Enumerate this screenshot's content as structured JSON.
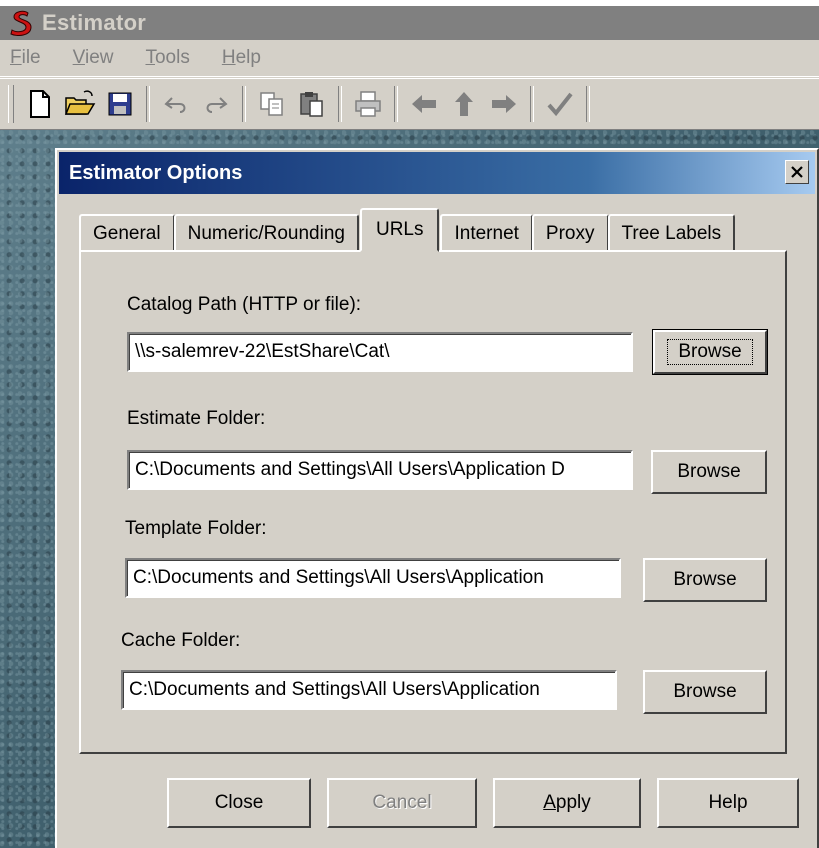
{
  "app": {
    "title": "Estimator",
    "logo_icon": "s-logo-icon"
  },
  "menu": [
    {
      "label_underlined": "F",
      "label_rest": "ile"
    },
    {
      "label_underlined": "V",
      "label_rest": "iew"
    },
    {
      "label_underlined": "T",
      "label_rest": "ools"
    },
    {
      "label_underlined": "H",
      "label_rest": "elp"
    }
  ],
  "toolbar": {
    "icons": [
      "new-file-icon",
      "open-folder-icon",
      "save-icon",
      "undo-icon",
      "redo-icon",
      "copy-icon",
      "paste-icon",
      "print-icon",
      "arrow-left-icon",
      "arrow-up-icon",
      "arrow-right-icon",
      "check-icon"
    ]
  },
  "dialog": {
    "title": "Estimator Options",
    "close_glyph": "×",
    "tabs": [
      {
        "label": "General"
      },
      {
        "label": "Numeric/Rounding"
      },
      {
        "label": "URLs"
      },
      {
        "label": "Internet"
      },
      {
        "label": "Proxy"
      },
      {
        "label": "Tree Labels"
      }
    ],
    "active_tab": "URLs",
    "fields": {
      "catalog": {
        "label": "Catalog Path (HTTP or file):",
        "value": "\\\\s-salemrev-22\\EstShare\\Cat\\",
        "button": "Browse"
      },
      "estimate": {
        "label": "Estimate Folder:",
        "value": "C:\\Documents and Settings\\All Users\\Application D",
        "button": "Browse"
      },
      "template": {
        "label": "Template Folder:",
        "value": "C:\\Documents and Settings\\All Users\\Application",
        "button": "Browse"
      },
      "cache": {
        "label": "Cache Folder:",
        "value": "C:\\Documents and Settings\\All Users\\Application",
        "button": "Browse"
      }
    },
    "footer": {
      "close": "Close",
      "cancel": "Cancel",
      "apply_underlined": "A",
      "apply_rest": "pply",
      "help": "Help"
    }
  }
}
